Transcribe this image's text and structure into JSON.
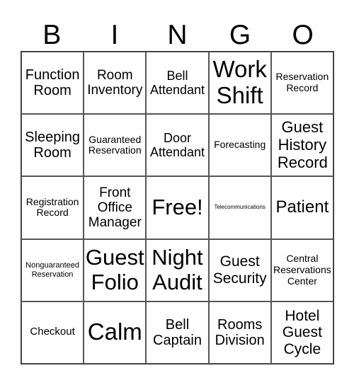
{
  "header": [
    "B",
    "I",
    "N",
    "G",
    "O"
  ],
  "cells": [
    "Function Room",
    "Room Inventory",
    "Bell Attendant",
    "Work Shift",
    "Reservation Record",
    "Sleeping Room",
    "Guaranteed Reservation",
    "Door Attendant",
    "Forecasting",
    "Guest History Record",
    "Registration Record",
    "Front Office Manager",
    "Free!",
    "Telecommunications",
    "Patient",
    "Nonguaranteed Reservation",
    "Guest Folio",
    "Night Audit",
    "Guest Security",
    "Central Reservations Center",
    "Checkout",
    "Calm",
    "Bell Captain",
    "Rooms Division",
    "Hotel Guest Cycle"
  ]
}
